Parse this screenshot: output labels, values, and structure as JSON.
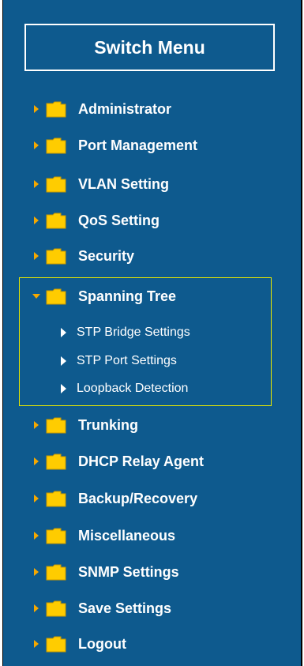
{
  "menu": {
    "title": "Switch Menu",
    "items": [
      {
        "label": "Administrator"
      },
      {
        "label": "Port Management"
      },
      {
        "label": "VLAN Setting"
      },
      {
        "label": "QoS Setting"
      },
      {
        "label": "Security"
      },
      {
        "label": "Spanning Tree",
        "expanded": true
      },
      {
        "label": "Trunking"
      },
      {
        "label": "DHCP Relay Agent"
      },
      {
        "label": "Backup/Recovery"
      },
      {
        "label": "Miscellaneous"
      },
      {
        "label": "SNMP Settings"
      },
      {
        "label": "Save Settings"
      },
      {
        "label": "Logout"
      }
    ],
    "spanning_tree_subitems": [
      {
        "label": "STP Bridge Settings"
      },
      {
        "label": "STP Port Settings"
      },
      {
        "label": "Loopback Detection"
      }
    ]
  },
  "colors": {
    "background": "#0e5a8e",
    "text": "#ffffff",
    "highlight_border": "#e8e800",
    "folder": "#ffcc00",
    "arrow": "#f5a800"
  }
}
